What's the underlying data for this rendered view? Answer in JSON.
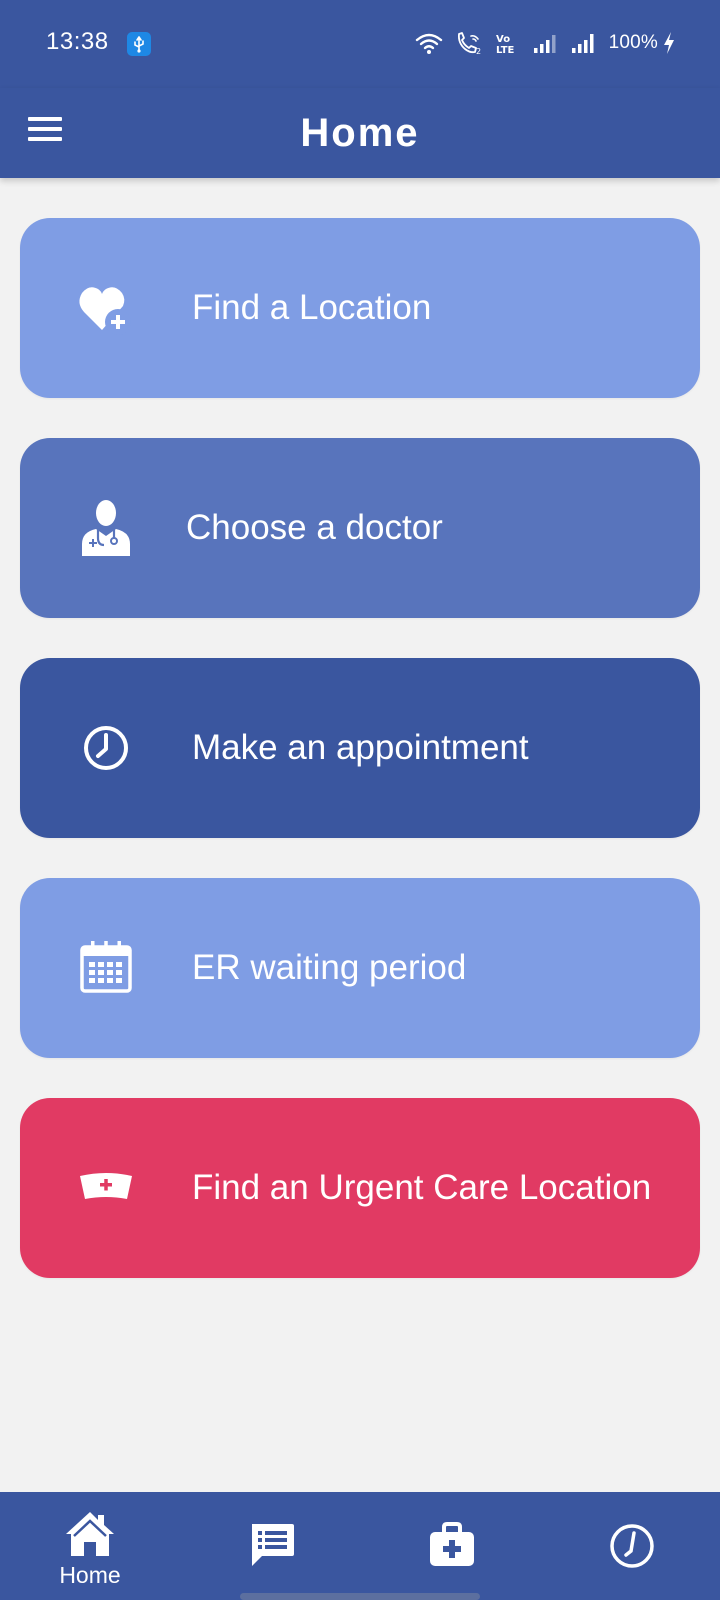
{
  "status_bar": {
    "time": "13:38",
    "battery": "100%"
  },
  "app_bar": {
    "title": "Home"
  },
  "cards": [
    {
      "label": "Find a Location",
      "icon": "heart-plus-icon",
      "color": "#7f9de4"
    },
    {
      "label": "Choose a doctor",
      "icon": "doctor-icon",
      "color": "#5874bc"
    },
    {
      "label": "Make an appointment",
      "icon": "clock-icon",
      "color": "#3a569f"
    },
    {
      "label": "ER waiting period",
      "icon": "calendar-icon",
      "color": "#7f9de4"
    },
    {
      "label": "Find an Urgent Care Location",
      "icon": "nurse-cap-icon",
      "color": "#e13a63"
    }
  ],
  "bottom_nav": {
    "items": [
      {
        "label": "Home",
        "icon": "home-icon",
        "active": true
      },
      {
        "label": "",
        "icon": "chat-icon",
        "active": false
      },
      {
        "label": "",
        "icon": "medical-kit-icon",
        "active": false
      },
      {
        "label": "",
        "icon": "clock-icon",
        "active": false
      }
    ]
  },
  "colors": {
    "primary": "#3a569f",
    "background": "#f2f2f2",
    "accent_red": "#e13a63"
  }
}
